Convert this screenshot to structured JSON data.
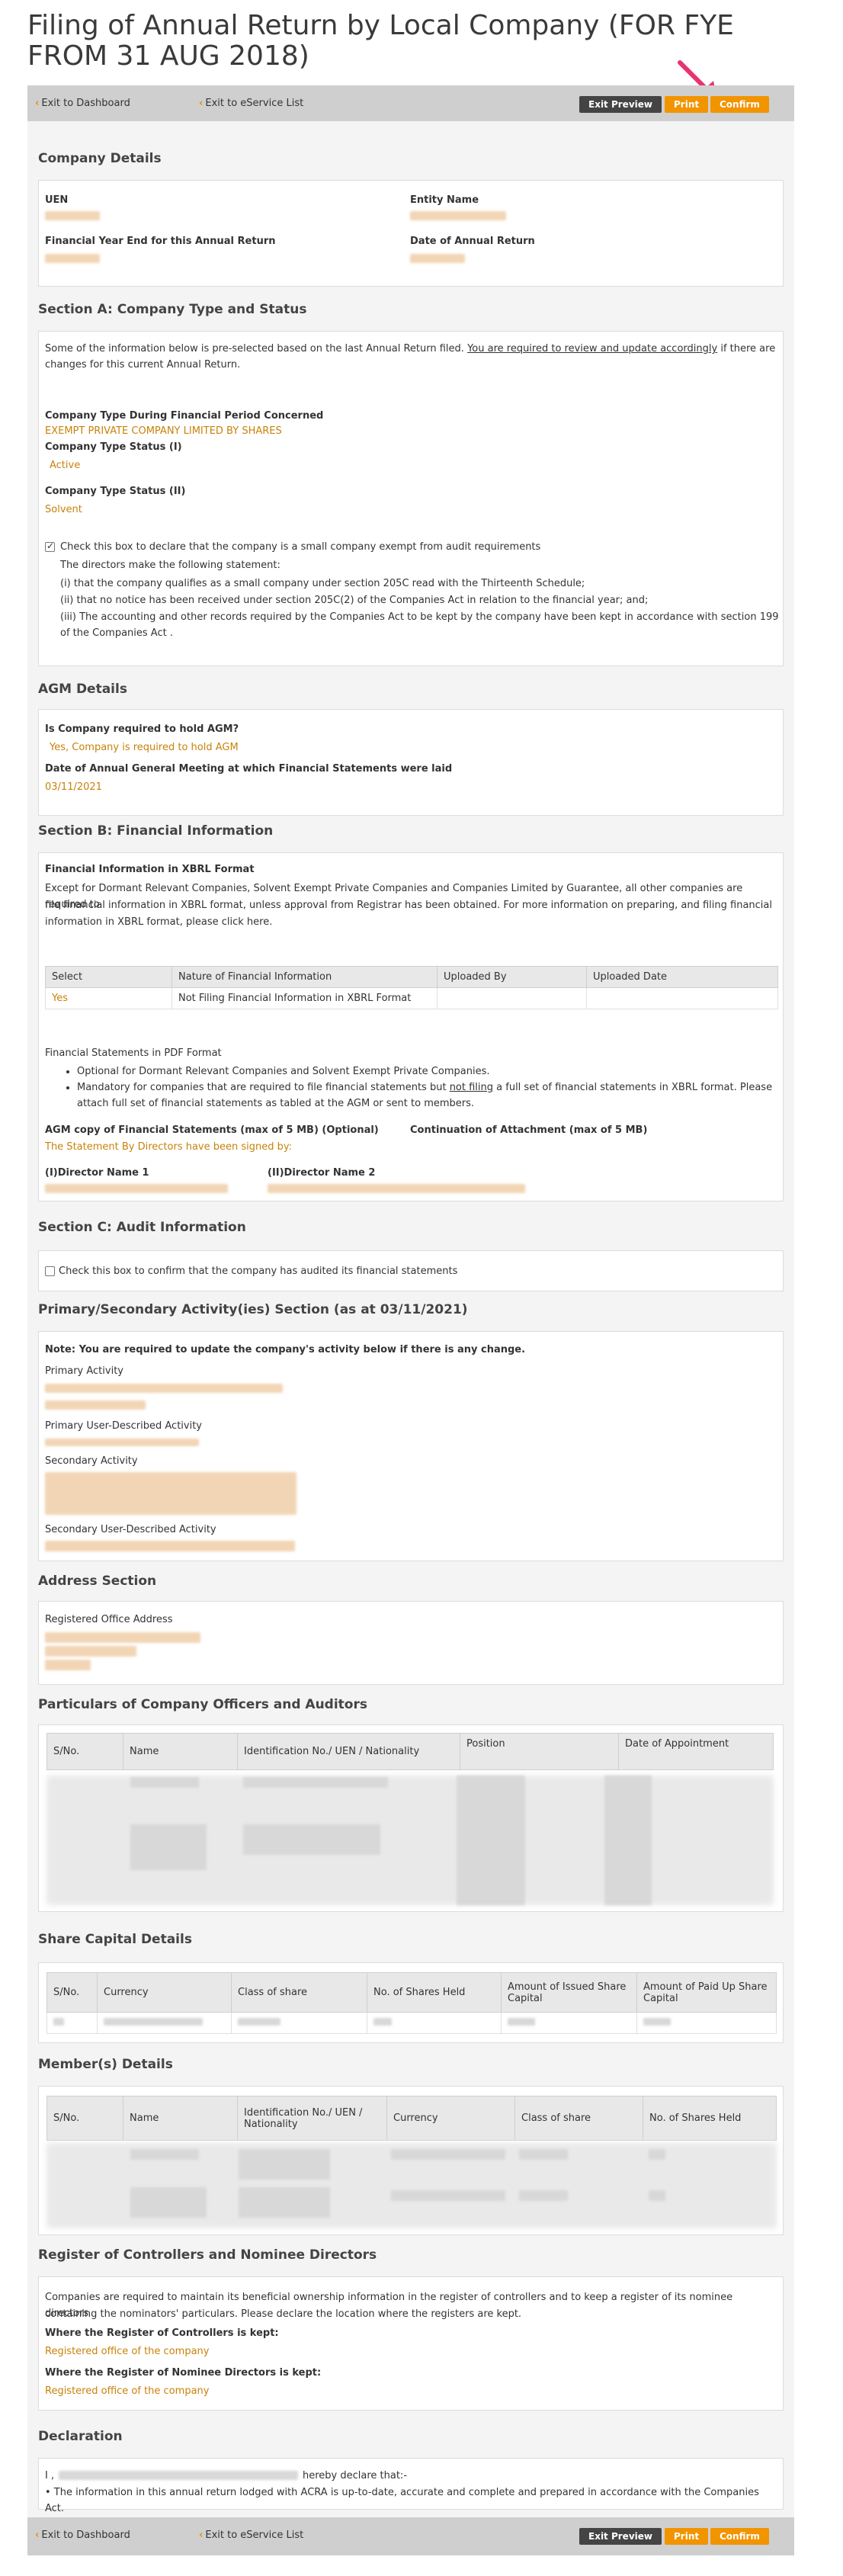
{
  "page": {
    "title": "Filing of Annual Return by Local Company (FOR FYE FROM 31 AUG 2018)"
  },
  "toolbar": {
    "exit_dashboard": "Exit to Dashboard",
    "exit_eservice": "Exit to eService List",
    "exit_preview": "Exit Preview",
    "print": "Print",
    "confirm": "Confirm"
  },
  "company_details": {
    "heading": "Company Details",
    "uen_label": "UEN",
    "entity_name_label": "Entity Name",
    "fye_label": "Financial Year End for this Annual Return",
    "ar_date_label": "Date of Annual Return"
  },
  "section_a": {
    "heading": "Section A: Company Type and Status",
    "intro_1": "Some of the information below is pre-selected based on the last Annual Return filed.",
    "intro_link": "You are required to review and update accordingly",
    "intro_2": "if there are",
    "intro_3": "changes for this current Annual Return.",
    "type_label": "Company Type During Financial Period Concerned",
    "type_value": "EXEMPT PRIVATE COMPANY LIMITED BY SHARES",
    "status1_label": "Company Type Status (I)",
    "status1_value": "Active",
    "status2_label": "Company Type Status (II)",
    "status2_value": "Solvent",
    "declare_text": "Check this box to declare that the company is a small company exempt from audit requirements",
    "directors_stmt": "The directors make the following statement:",
    "stmt_1": "(i) that the company qualifies as a small company under section 205C read with the Thirteenth Schedule;",
    "stmt_2": "(ii) that no notice has been received under section 205C(2) of the Companies Act in relation to the financial year; and;",
    "stmt_3a": "(iii) The accounting and other records required by the Companies Act to be kept by the company have been kept in accordance with section 199",
    "stmt_3b": "of the Companies Act ."
  },
  "agm": {
    "heading": "AGM Details",
    "required_label": "Is Company required to hold AGM?",
    "required_value": "Yes, Company is required to hold AGM",
    "date_label": "Date of Annual General Meeting at which Financial Statements were laid",
    "date_value": "03/11/2021"
  },
  "section_b": {
    "heading": "Section B: Financial Information",
    "xbrl_title": "Financial Information in XBRL Format",
    "xbrl_text_1": "Except for Dormant Relevant Companies, Solvent Exempt Private Companies and Companies Limited by Guarantee, all other companies are required to",
    "xbrl_text_2": "file financial information in XBRL format, unless approval from Registrar has been obtained. For more information on preparing, and filing financial",
    "xbrl_text_3": "information in XBRL format, please click here.",
    "table_headers": [
      "Select",
      "Nature of Financial Information",
      "Uploaded By",
      "Uploaded Date"
    ],
    "table_row": [
      "Yes",
      "Not Filing Financial Information in XBRL Format",
      "",
      ""
    ],
    "pdf_title": "Financial Statements in PDF Format",
    "pdf_bullet_1": "Optional for Dormant Relevant Companies and Solvent Exempt Private Companies.",
    "pdf_bullet_2a": "Mandatory for companies that are required to file financial statements but",
    "pdf_bullet_2_link": "not filing",
    "pdf_bullet_2b": "a full set of financial statements in XBRL format. Please",
    "pdf_bullet_2c": "attach full set of financial statements as tabled at the AGM or sent to members.",
    "agm_copy_label": "AGM copy of Financial Statements (max of 5 MB) (Optional)",
    "continuation_label": "Continuation of Attachment (max of 5 MB)",
    "signed_by": "The Statement By Directors have been signed by:",
    "director1_label": "(I)Director Name 1",
    "director2_label": "(II)Director Name 2"
  },
  "section_c": {
    "heading": "Section C: Audit Information",
    "check_text": "Check this box to confirm that the company has audited its financial statements"
  },
  "activity": {
    "heading": "Primary/Secondary Activity(ies) Section (as at 03/11/2021)",
    "note": "Note: You are required to update the company's activity below if there is any change.",
    "primary_label": "Primary Activity",
    "primary_user_label": "Primary User-Described Activity",
    "secondary_label": "Secondary Activity",
    "secondary_user_label": "Secondary User-Described Activity"
  },
  "address": {
    "heading": "Address Section",
    "registered_label": "Registered Office Address"
  },
  "officers": {
    "heading": "Particulars of Company Officers and Auditors",
    "headers": [
      "S/No.",
      "Name",
      "Identification No./ UEN / Nationality",
      "Position",
      "Date of Appointment"
    ]
  },
  "share_capital": {
    "heading": "Share Capital Details",
    "headers": [
      "S/No.",
      "Currency",
      "Class of share",
      "No. of Shares Held",
      "Amount of Issued Share Capital",
      "Amount of Paid Up Share Capital"
    ]
  },
  "members": {
    "heading": "Member(s) Details",
    "headers": [
      "S/No.",
      "Name",
      "Identification No./ UEN / Nationality",
      "Currency",
      "Class of share",
      "No. of Shares Held"
    ]
  },
  "controllers": {
    "heading": "Register of Controllers and Nominee Directors",
    "text_1": "Companies are required to maintain its beneficial ownership information in the register of controllers and to keep a register of its nominee directors",
    "text_2": "containing the nominators' particulars. Please declare the location where the registers are kept.",
    "controllers_label": "Where the Register of Controllers is kept:",
    "controllers_value": "Registered office of the company",
    "nominee_label": "Where the Register of Nominee Directors is kept:",
    "nominee_value": "Registered office of the company"
  },
  "declaration": {
    "heading": "Declaration",
    "prefix": "I ,",
    "suffix": "hereby declare that:-",
    "bullet": "• The information in this annual return lodged with ACRA is up-to-date, accurate and complete and prepared in accordance with the Companies Act."
  },
  "colors": {
    "accent_orange": "#f29400",
    "value_orange": "#c8820a",
    "arrow_pink": "#e8336d"
  }
}
